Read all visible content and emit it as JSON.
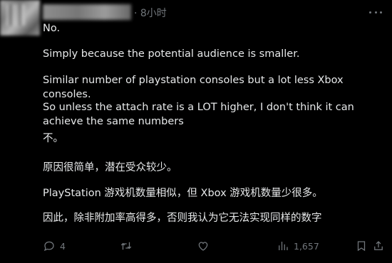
{
  "post": {
    "time": "· 8小时",
    "paragraphs": [
      "No.",
      "Simply because the potential audience is smaller.",
      "Similar number of playstation consoles but a lot less Xbox consoles.",
      "So unless the attach rate is a LOT higher, I don't think it can achieve the same numbers",
      "不。",
      "原因很简单，潜在受众较少。",
      "PlayStation 游戏机数量相似，但 Xbox 游戏机数量少很多。",
      "因此，除非附加率高得多，否则我认为它无法实现同样的数字"
    ]
  },
  "actions": {
    "reply_count": "4",
    "retweet_count": "",
    "like_count": "",
    "views_count": "1,657",
    "icons": [
      "reply-icon",
      "retweet-icon",
      "like-icon",
      "views-icon",
      "bookmark-icon",
      "share-icon"
    ]
  },
  "colors": {
    "background": "#000000",
    "text": "#e7e9ea",
    "muted": "#71767b"
  }
}
